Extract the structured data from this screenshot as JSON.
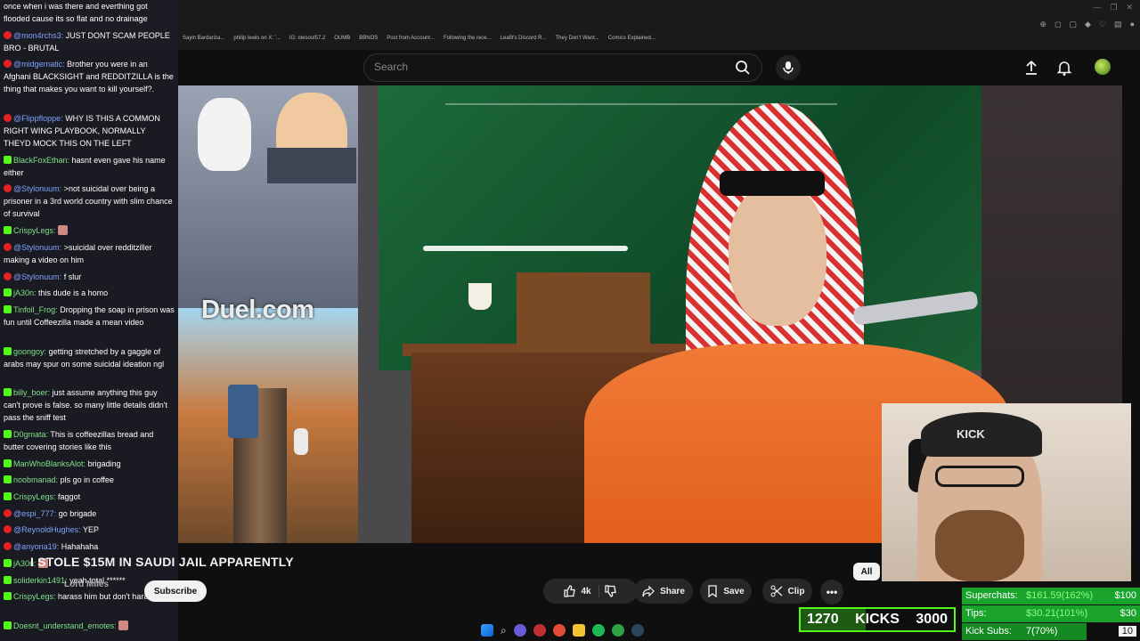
{
  "browser": {
    "bookmarks": [
      "Sayin Bardariza...",
      "philip lewis on X: '...",
      "IG: olesoul57.2",
      "OUMB",
      "BBNOS",
      "Post from Account...",
      "Following the rece...",
      "Leafit's Discord R...",
      "They Don't Want...",
      "Comics Explained..."
    ]
  },
  "youtube": {
    "search_placeholder": "Search",
    "video_title": "I STOLE $15M IN SAUDI JAIL APPARENTLY",
    "channel_name": "Lord Miles",
    "subscribe_label": "Subscribe",
    "like_count": "4k",
    "share_label": "Share",
    "save_label": "Save",
    "clip_label": "Clip",
    "chip_all": "All",
    "video_overlay_text": "Duel.com"
  },
  "chat": [
    {
      "source": "none",
      "user": "",
      "text": "once when i was there and everthing got flooded cause its so flat and no drainage"
    },
    {
      "source": "youtube",
      "user": "@mon4rchs3:",
      "text": "JUST DONT SCAM PEOPLE BRO - BRUTAL"
    },
    {
      "source": "youtube",
      "user": "@midgematic:",
      "text": "Brother you were in an Afghani BLACKSIGHT and REDDITZILLA is the thing that makes you want to kill yourself?."
    },
    {
      "source": "youtube",
      "user": "@Flippfloppe:",
      "text": "WHY IS THIS A COMMON RIGHT WING PLAYBOOK, NORMALLY THEYD MOCK THIS ON THE LEFT"
    },
    {
      "source": "kick",
      "user": "BlackFoxEthan:",
      "text": "hasnt even gave his name either"
    },
    {
      "source": "youtube",
      "user": "@Stylonuum:",
      "text": ">not suicidal over being a prisoner in a 3rd world country with slim chance of survival"
    },
    {
      "source": "kick",
      "user": "CrispyLegs:",
      "text": ""
    },
    {
      "source": "youtube",
      "user": "@Stylonuum:",
      "text": ">suicidal over redditziller making a video on him"
    },
    {
      "source": "youtube",
      "user": "@Stylonuum:",
      "text": "f slur"
    },
    {
      "source": "kick",
      "user": "jA30n:",
      "text": "this dude is a homo"
    },
    {
      "source": "kick",
      "user": "Tinfoil_Frog:",
      "text": "Dropping the soap in prison was fun until Coffeezilla made a mean video"
    },
    {
      "source": "kick",
      "user": "goongoy:",
      "text": "getting stretched by a gaggle of arabs may spur on some suicidal ideation ngl"
    },
    {
      "source": "kick",
      "user": "billy_boer:",
      "text": "just assume anything this guy can't prove is false. so many little details didn't pass the sniff test"
    },
    {
      "source": "kick",
      "user": "D0gmata:",
      "text": "This is coffeezillas bread and butter covering stories like this"
    },
    {
      "source": "kick",
      "user": "ManWhoBlanksAlot:",
      "text": "brigading"
    },
    {
      "source": "kick",
      "user": "noobmanad:",
      "text": "pls go in coffee"
    },
    {
      "source": "kick",
      "user": "CrispyLegs:",
      "text": "faggot"
    },
    {
      "source": "youtube",
      "user": "@espi_777:",
      "text": "go brigade"
    },
    {
      "source": "youtube",
      "user": "@ReynoldHughes:",
      "text": "YEP"
    },
    {
      "source": "youtube",
      "user": "@anyona19:",
      "text": "Hahahaha"
    },
    {
      "source": "kick",
      "user": "jA30n:",
      "text": ""
    },
    {
      "source": "kick",
      "user": "soliderkin1491:",
      "text": "yeah total ******"
    },
    {
      "source": "kick",
      "user": "CrispyLegs:",
      "text": "harass him but don't harass him"
    },
    {
      "source": "kick",
      "user": "Doesnt_understand_emotes:",
      "text": ""
    }
  ],
  "webcam": {
    "hat_text": "KICK"
  },
  "kicks_goal": {
    "current": "1270",
    "label": "KICKS",
    "goal": "3000",
    "progress": 0.4233
  },
  "donations": [
    {
      "label": "Superchats:",
      "value": "$161.59(162%)",
      "target": "$100",
      "progress": 1.0
    },
    {
      "label": "Tips:",
      "value": "$30.21(101%)",
      "target": "$30",
      "progress": 1.0
    },
    {
      "label": "Kick Subs:",
      "value": "7(70%)",
      "target": "10",
      "progress": 0.7
    }
  ],
  "colors": {
    "kick_green": "#53fc18",
    "youtube_red": "#e52222",
    "bar_green": "#1aa32b"
  }
}
